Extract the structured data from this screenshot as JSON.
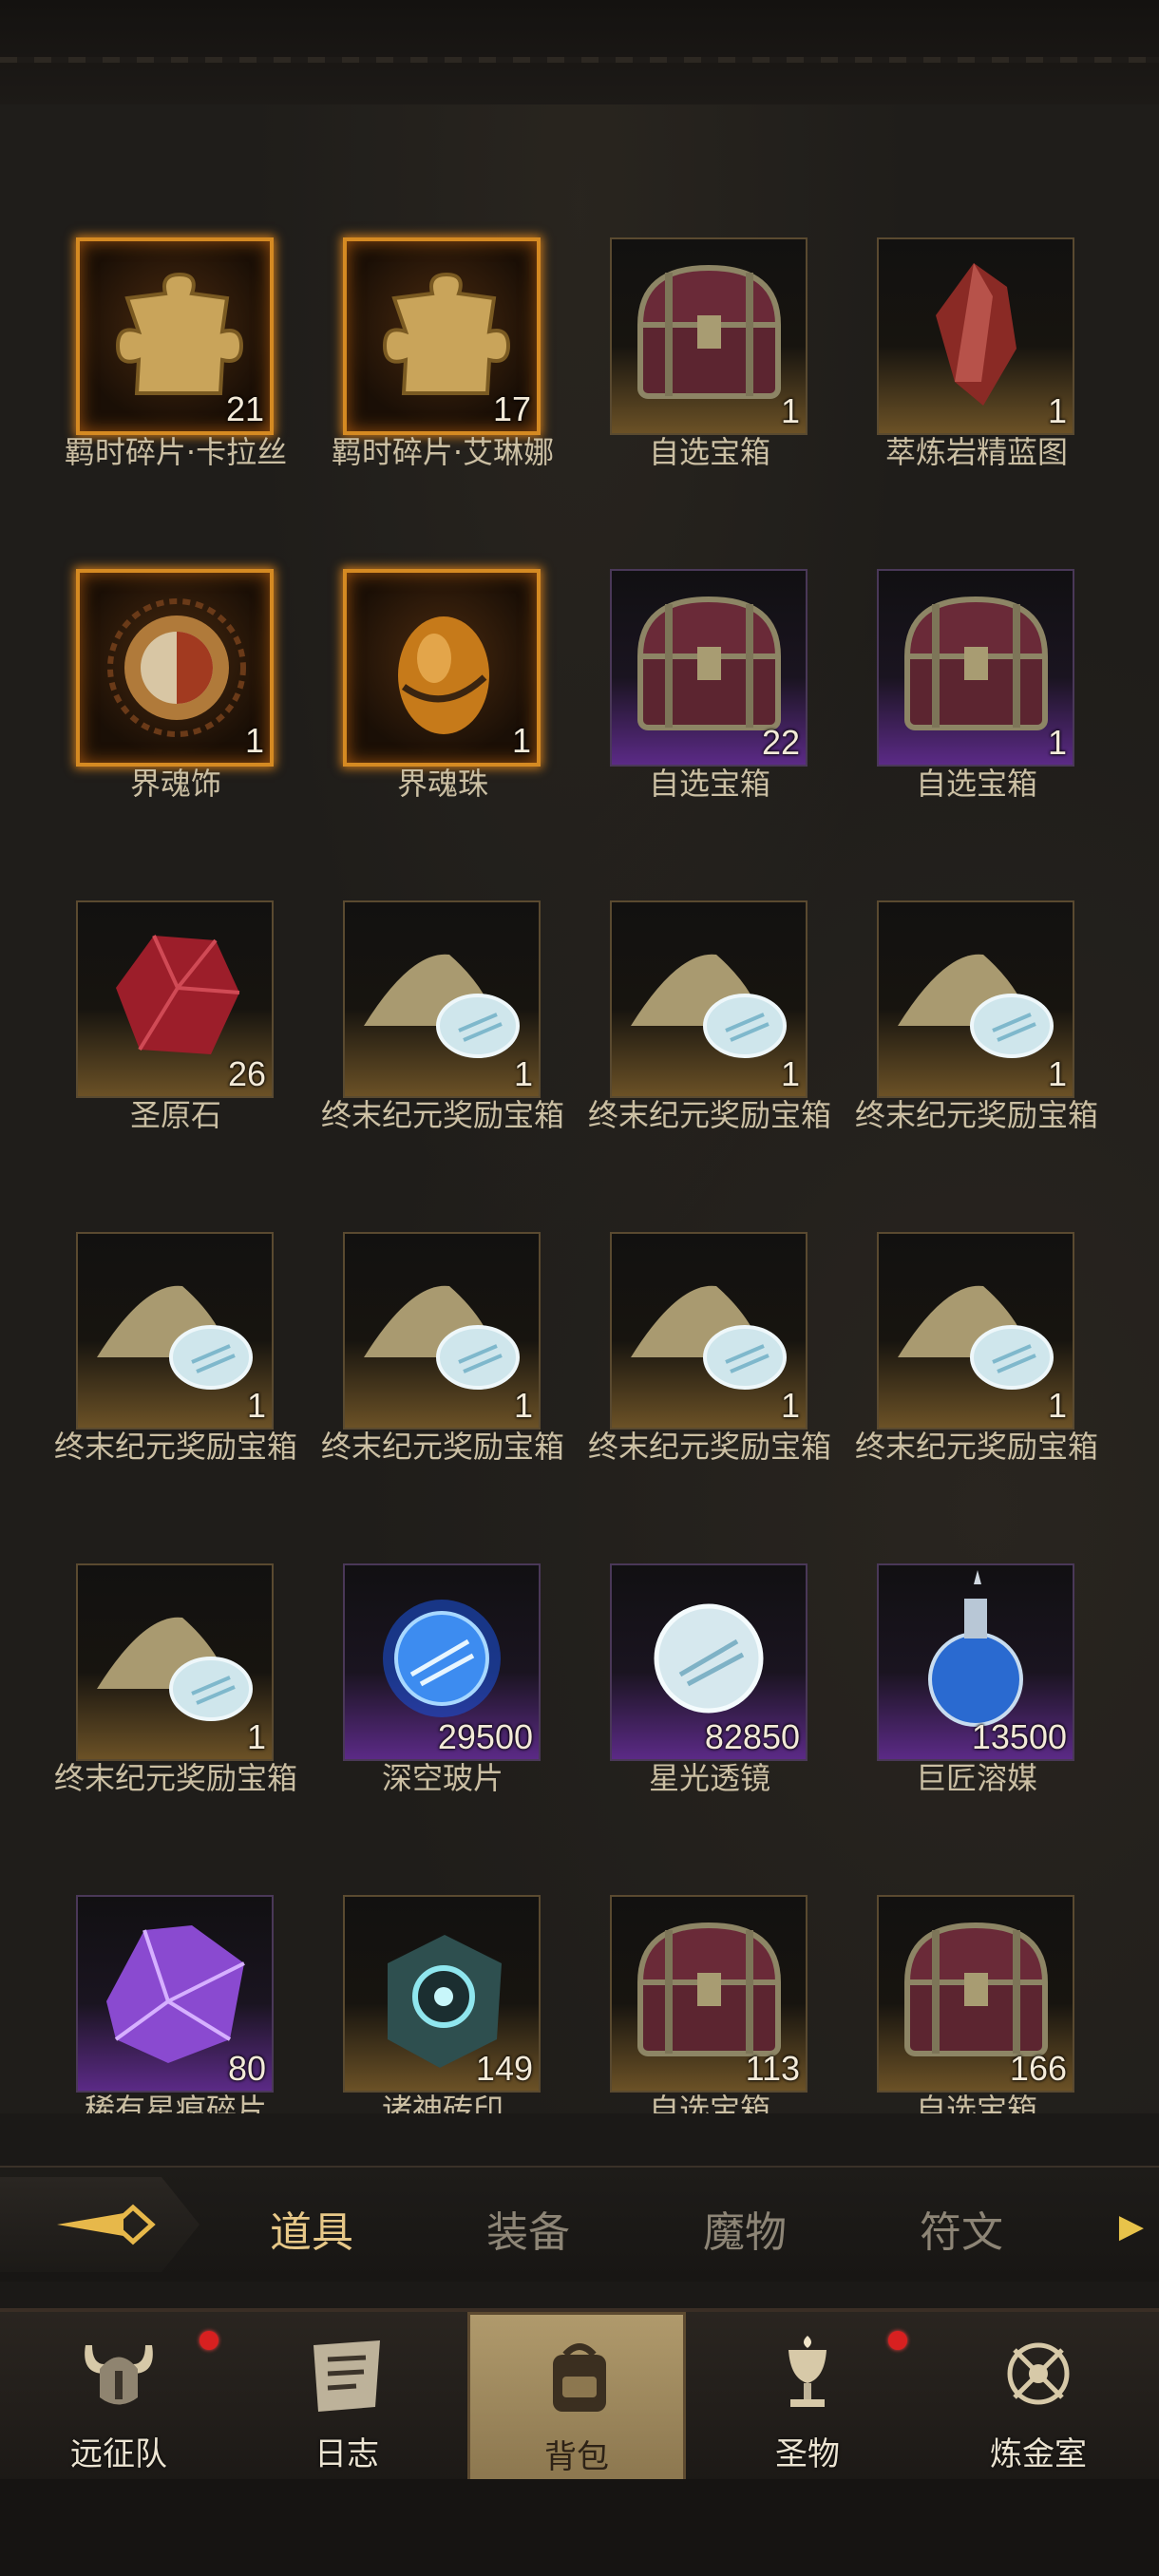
{
  "items": [
    {
      "name": "羁时碎片·卡拉丝",
      "count": "21",
      "rarity": "gold",
      "icon": "puzzle-piece-icon"
    },
    {
      "name": "羁时碎片·艾琳娜",
      "count": "17",
      "rarity": "gold",
      "icon": "puzzle-piece-icon"
    },
    {
      "name": "自选宝箱",
      "count": "1",
      "rarity": "bronze",
      "icon": "treasure-chest-icon"
    },
    {
      "name": "萃炼岩精蓝图",
      "count": "1",
      "rarity": "bronze",
      "icon": "red-crystal-icon"
    },
    {
      "name": "界魂饰",
      "count": "1",
      "rarity": "gold",
      "icon": "sun-amulet-icon"
    },
    {
      "name": "界魂珠",
      "count": "1",
      "rarity": "gold",
      "icon": "amber-orb-icon"
    },
    {
      "name": "自选宝箱",
      "count": "22",
      "rarity": "purple",
      "icon": "treasure-chest-icon"
    },
    {
      "name": "自选宝箱",
      "count": "1",
      "rarity": "purple",
      "icon": "treasure-chest-icon"
    },
    {
      "name": "圣原石",
      "count": "26",
      "rarity": "bronze",
      "icon": "ruby-gem-icon"
    },
    {
      "name": "终末纪元奖励宝箱",
      "count": "1",
      "rarity": "bronze",
      "icon": "sand-lens-icon"
    },
    {
      "name": "终末纪元奖励宝箱",
      "count": "1",
      "rarity": "bronze",
      "icon": "sand-lens-icon"
    },
    {
      "name": "终末纪元奖励宝箱",
      "count": "1",
      "rarity": "bronze",
      "icon": "sand-lens-icon"
    },
    {
      "name": "终末纪元奖励宝箱",
      "count": "1",
      "rarity": "bronze",
      "icon": "sand-lens-icon"
    },
    {
      "name": "终末纪元奖励宝箱",
      "count": "1",
      "rarity": "bronze",
      "icon": "sand-lens-icon"
    },
    {
      "name": "终末纪元奖励宝箱",
      "count": "1",
      "rarity": "bronze",
      "icon": "sand-lens-icon"
    },
    {
      "name": "终末纪元奖励宝箱",
      "count": "1",
      "rarity": "bronze",
      "icon": "sand-lens-icon"
    },
    {
      "name": "终末纪元奖励宝箱",
      "count": "1",
      "rarity": "bronze",
      "icon": "sand-lens-icon"
    },
    {
      "name": "深空玻片",
      "count": "29500",
      "rarity": "purple",
      "icon": "blue-lens-icon"
    },
    {
      "name": "星光透镜",
      "count": "82850",
      "rarity": "purple",
      "icon": "star-lens-icon"
    },
    {
      "name": "巨匠溶媒",
      "count": "13500",
      "rarity": "purple",
      "icon": "potion-flask-icon"
    },
    {
      "name": "稀有星痕碎片",
      "count": "80",
      "rarity": "purple",
      "icon": "purple-shard-icon"
    },
    {
      "name": "诸神砖印",
      "count": "149",
      "rarity": "bronze",
      "icon": "rune-cube-icon"
    },
    {
      "name": "自选宝箱",
      "count": "113",
      "rarity": "bronze",
      "icon": "treasure-chest-icon"
    },
    {
      "name": "自选宝箱",
      "count": "166",
      "rarity": "bronze",
      "icon": "treasure-chest-icon"
    }
  ],
  "tabs": {
    "items": [
      {
        "label": "道具",
        "active": true
      },
      {
        "label": "装备",
        "active": false
      },
      {
        "label": "魔物",
        "active": false
      },
      {
        "label": "符文",
        "active": false
      }
    ]
  },
  "nav": {
    "items": [
      {
        "label": "远征队",
        "icon": "viking-helmet-icon",
        "badge": true
      },
      {
        "label": "日志",
        "icon": "scroll-log-icon",
        "badge": false
      },
      {
        "label": "背包",
        "icon": "backpack-icon",
        "badge": false,
        "active": true
      },
      {
        "label": "圣物",
        "icon": "chalice-icon",
        "badge": true
      },
      {
        "label": "炼金室",
        "icon": "alchemy-icon",
        "badge": false
      }
    ]
  },
  "colors": {
    "accent_gold": "#e7c888",
    "rarity_gold": "#d58a22",
    "rarity_purple": "#5b2a86",
    "badge_red": "#d82020"
  }
}
